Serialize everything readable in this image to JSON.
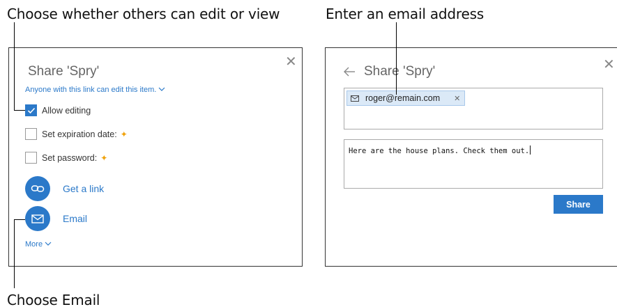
{
  "callouts": {
    "top_left": "Choose whether others can edit or view",
    "top_right": "Enter an email address",
    "bottom_left": "Choose Email"
  },
  "left_panel": {
    "title": "Share 'Spry'",
    "permission_link": "Anyone with this link can edit this item.",
    "options": [
      {
        "label": "Allow editing",
        "checked": true,
        "premium": false
      },
      {
        "label": "Set expiration date:",
        "checked": false,
        "premium": true
      },
      {
        "label": "Set password:",
        "checked": false,
        "premium": true
      }
    ],
    "actions": [
      {
        "label": "Get a link",
        "icon": "link-icon"
      },
      {
        "label": "Email",
        "icon": "envelope-icon"
      }
    ],
    "more_label": "More",
    "close_icon": "close-icon"
  },
  "right_panel": {
    "title": "Share 'Spry'",
    "recipient": "roger@remain.com",
    "message": "Here are the house plans. Check them out.",
    "share_label": "Share",
    "back_icon": "back-arrow-icon",
    "close_icon": "close-icon"
  },
  "colors": {
    "accent": "#2b79c9",
    "premium_star": "#f0a20c",
    "chip_bg": "#dbe9f7"
  }
}
